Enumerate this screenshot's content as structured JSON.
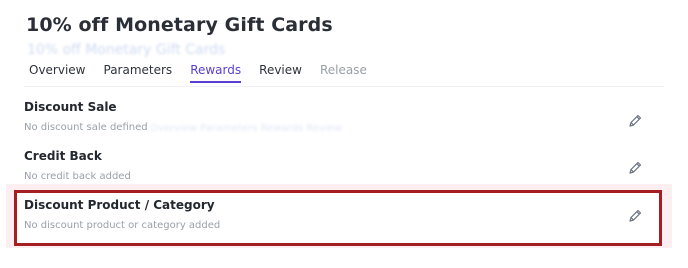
{
  "header": {
    "title": "10% off Monetary Gift Cards",
    "subtitle_ghost": "10% off Monetary Gift Cards"
  },
  "tabs": [
    {
      "label": "Overview",
      "state": "normal"
    },
    {
      "label": "Parameters",
      "state": "normal"
    },
    {
      "label": "Rewards",
      "state": "active"
    },
    {
      "label": "Review",
      "state": "normal"
    },
    {
      "label": "Release",
      "state": "disabled"
    }
  ],
  "sections": [
    {
      "title": "Discount Sale",
      "empty_text": "No discount sale defined"
    },
    {
      "title": "Credit Back",
      "empty_text": "No credit back added"
    },
    {
      "title": "Discount Product / Category",
      "empty_text": "No discount product or category added"
    }
  ],
  "ghost_row_text": "Overview   Parameters   Rewards   Review",
  "icons": {
    "edit": "pencil-icon"
  },
  "colors": {
    "accent": "#5a3fd1",
    "highlight_border": "#a41e22",
    "highlight_glow": "#fdeef2",
    "muted_text": "#9aa0a8",
    "icon": "#6b7380"
  }
}
